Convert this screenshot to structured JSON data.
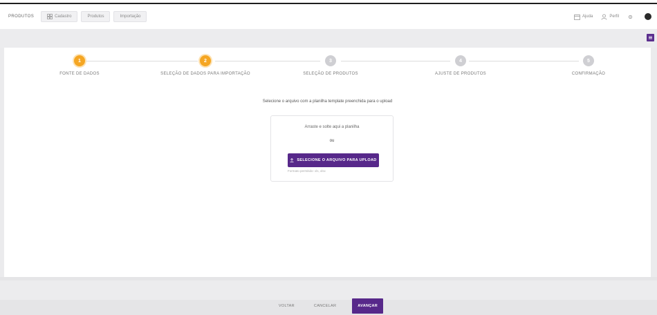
{
  "header": {
    "brand": "PRODUTOS",
    "breadcrumbs": [
      {
        "label": "Cadastro",
        "icon": "grid-icon"
      },
      {
        "label": "Produtos",
        "icon": ""
      },
      {
        "label": "Importação",
        "icon": ""
      }
    ],
    "right": [
      {
        "label": "Ajuda",
        "icon": "calendar-icon"
      },
      {
        "label": "Perfil",
        "icon": "user-icon"
      }
    ]
  },
  "stepper": {
    "steps": [
      {
        "number": "1",
        "label": "FONTE DE DADOS",
        "state": "active"
      },
      {
        "number": "2",
        "label": "SELEÇÃO DE DADOS PARA IMPORTAÇÃO",
        "state": "active"
      },
      {
        "number": "3",
        "label": "SELEÇÃO DE PRODUTOS",
        "state": "inactive"
      },
      {
        "number": "4",
        "label": "AJUSTE DE PRODUTOS",
        "state": "inactive"
      },
      {
        "number": "5",
        "label": "CONFIRMAÇÃO",
        "state": "inactive"
      }
    ]
  },
  "main": {
    "instruction": "Selecione o arquivo com a planilha template preenchida para o upload",
    "upload": {
      "drag_text": "Arraste e solte aqui a planilha",
      "or_text": "ou",
      "button_label": "SELECIONE O ARQUIVO PARA UPLOAD",
      "hint": "Formato permitido: xls, xlsx"
    }
  },
  "footer": {
    "back_label": "VOLTAR",
    "cancel_label": "CANCELAR",
    "next_label": "AVANÇAR"
  },
  "colors": {
    "accent": "#57288a",
    "step_active": "#f5a623",
    "step_inactive": "#cfcfd3"
  }
}
